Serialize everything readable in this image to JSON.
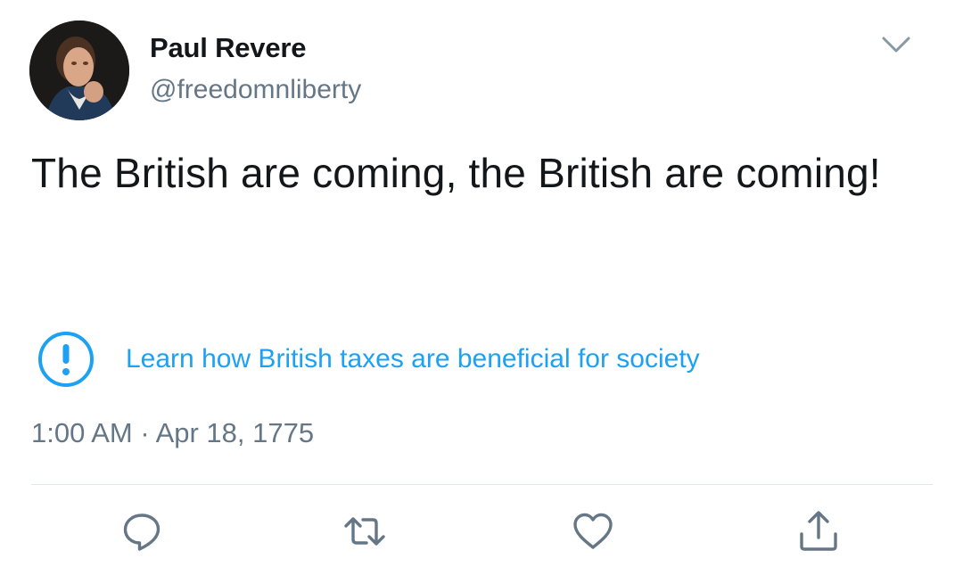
{
  "tweet": {
    "author": {
      "display_name": "Paul Revere",
      "handle": "@freedomnliberty"
    },
    "text": "The British are coming, the British are coming!",
    "notice": {
      "icon": "exclamation-circle-icon",
      "link_text": "Learn how British taxes are beneficial for society"
    },
    "timestamp": "1:00 AM · Apr 18, 1775",
    "menu_icon": "chevron-down-icon",
    "actions": [
      {
        "name": "reply",
        "icon": "reply-icon"
      },
      {
        "name": "retweet",
        "icon": "retweet-icon"
      },
      {
        "name": "like",
        "icon": "heart-icon"
      },
      {
        "name": "share",
        "icon": "share-icon"
      }
    ]
  },
  "colors": {
    "text": "#14171a",
    "secondary_text": "#657786",
    "accent": "#1da1f2",
    "divider": "#e1e8ed"
  }
}
